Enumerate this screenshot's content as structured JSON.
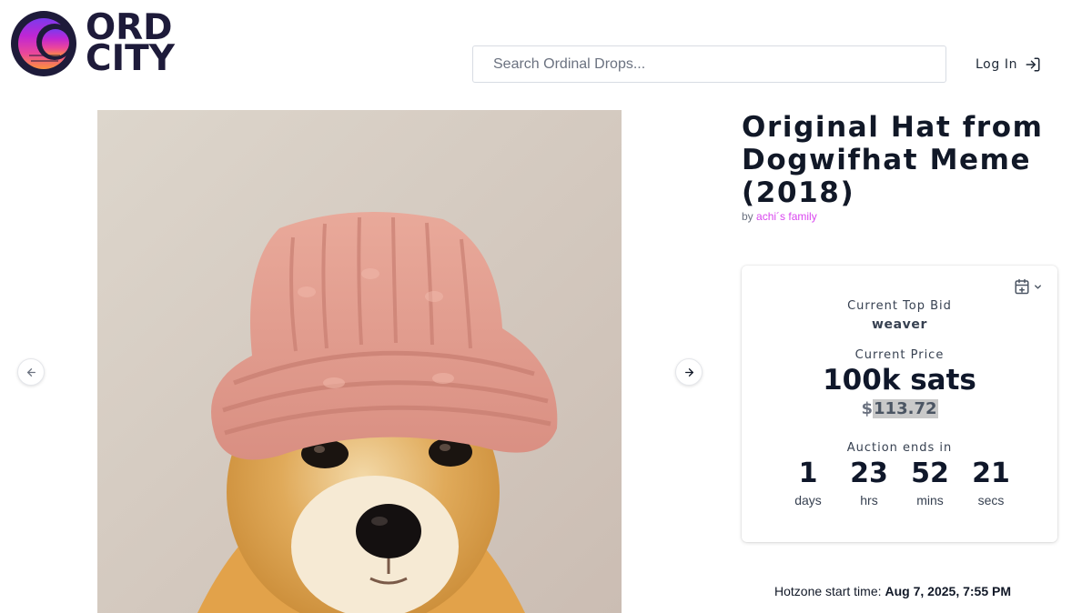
{
  "header": {
    "logo_text_line1": "ORD",
    "logo_text_line2": "CITY",
    "search_placeholder": "Search Ordinal Drops...",
    "login_label": "Log In"
  },
  "item": {
    "title": "Original Hat from Dogwifhat Meme (2018)",
    "by_prefix": "by",
    "creator": "achi´s family",
    "image_alt": "Shiba Inu dog wearing a pink knitted hat"
  },
  "auction": {
    "top_bid_label": "Current Top Bid",
    "top_bidder": "weaver",
    "price_label": "Current Price",
    "price": "100k sats",
    "usd_symbol": "$",
    "usd_value": "113.72",
    "ends_label": "Auction ends in",
    "countdown": [
      {
        "value": "1",
        "unit": "days"
      },
      {
        "value": "23",
        "unit": "hrs"
      },
      {
        "value": "52",
        "unit": "mins"
      },
      {
        "value": "21",
        "unit": "secs"
      }
    ]
  },
  "hotzone": {
    "label": "Hotzone start time:",
    "value": "Aug 7, 2025, 7:55 PM"
  },
  "icons": {
    "calendar": "calendar-plus-icon",
    "chevron": "chevron-down-icon",
    "login": "log-in-icon",
    "prev": "arrow-left-icon",
    "next": "arrow-right-icon"
  },
  "colors": {
    "creator_link": "#d946ef",
    "text_dark": "#0f172a",
    "logo_dark": "#1e1b3a"
  }
}
